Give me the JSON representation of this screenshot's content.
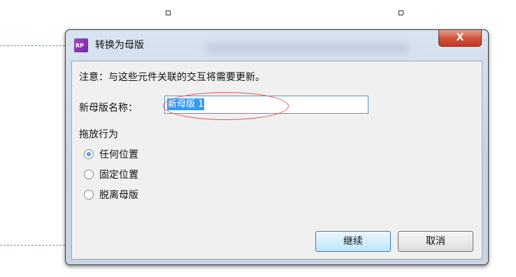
{
  "dialog": {
    "title": "转换为母版",
    "icon_text": "RP",
    "close_label": "X",
    "note": "注意：与这些元件关联的交互将需要更新。",
    "name_label": "新母版名称：",
    "name_value": "新母版 1",
    "drop_behavior_label": "拖放行为",
    "options": [
      {
        "label": "任何位置",
        "checked": true
      },
      {
        "label": "固定位置",
        "checked": false
      },
      {
        "label": "脱离母版",
        "checked": false
      }
    ],
    "continue_label": "继续",
    "cancel_label": "取消"
  }
}
